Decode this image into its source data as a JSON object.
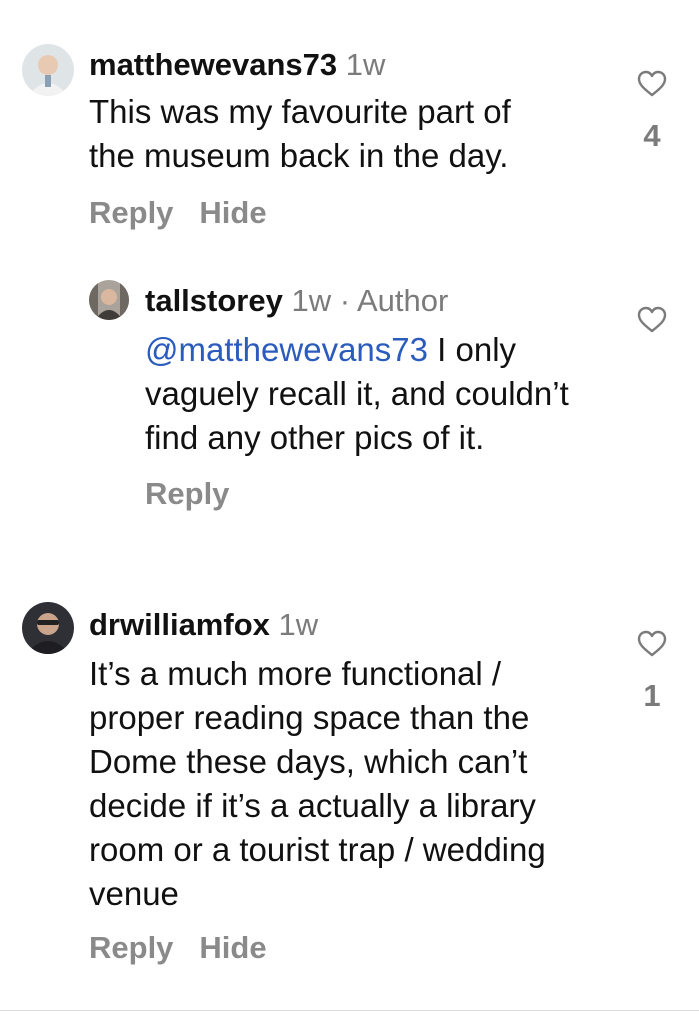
{
  "comments": [
    {
      "username": "matthewevans73",
      "time": "1w",
      "tag": "",
      "text_lines": [
        "This was my favourite part of",
        "the museum back in the day."
      ],
      "mention": "",
      "reply_label": "Reply",
      "hide_label": "Hide",
      "likes": "4",
      "like_icon": "heart-outline-icon",
      "avatar_colors": [
        "#cfd8de",
        "#e9e3da"
      ]
    },
    {
      "username": "tallstorey",
      "time": "1w",
      "tag": "· Author",
      "mention": "@matthewevans73",
      "text_first_rest": " I only",
      "text_lines": [
        "vaguely recall it, and couldn’t",
        "find any other pics of it."
      ],
      "reply_label": "Reply",
      "likes": "",
      "like_icon": "heart-outline-icon",
      "avatar_colors": [
        "#b9b4ad",
        "#6f6a63"
      ]
    },
    {
      "username": "drwilliamfox",
      "time": "1w",
      "tag": "",
      "text_lines": [
        "It’s a much more functional /",
        "proper reading space than the",
        "Dome these days, which can’t",
        "decide if it’s a actually a library",
        "room or a tourist trap / wedding",
        "venue"
      ],
      "mention": "",
      "reply_label": "Reply",
      "hide_label": "Hide",
      "likes": "1",
      "like_icon": "heart-outline-icon",
      "avatar_colors": [
        "#2d2d33",
        "#c9a58c"
      ]
    }
  ]
}
